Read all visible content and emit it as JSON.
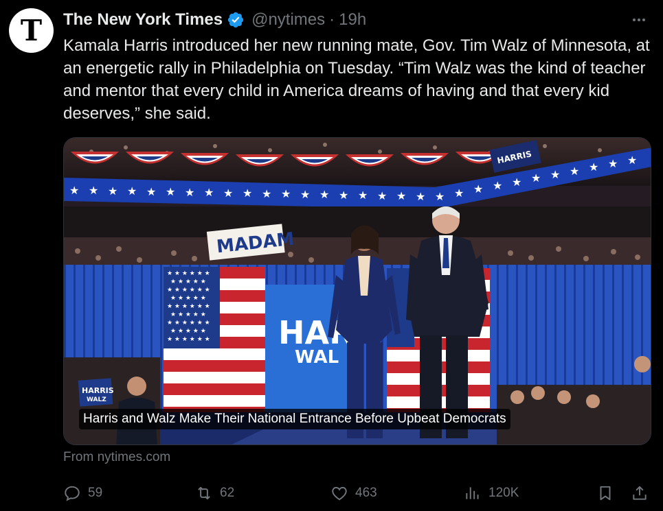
{
  "account": {
    "avatar_letter": "T",
    "name": "The New York Times",
    "handle": "@nytimes",
    "separator": "·",
    "time": "19h",
    "verified_color": "#1d9bf0"
  },
  "tweet": {
    "text": "Kamala Harris introduced her new running mate, Gov. Tim Walz of Minnesota, at an energetic rally in Philadelphia on Tuesday. “Tim Walz was the kind of teacher and mentor that every child in America dreams of having and that every kid deserves,” she said."
  },
  "card": {
    "caption": "Harris and Walz Make Their National Entrance Before Upbeat Democrats",
    "source": "From nytimes.com",
    "photo_signs": {
      "madam": "MADAM",
      "harris_left": "HARRIS",
      "walz_left": "WALZ",
      "harris_podium": "HAR",
      "walz_podium": "WAL",
      "harris_right": "HARRIS"
    }
  },
  "actions": {
    "replies": "59",
    "reposts": "62",
    "likes": "463",
    "views": "120K"
  },
  "icons": [
    "verified-badge-icon",
    "more-icon",
    "reply-icon",
    "repost-icon",
    "like-icon",
    "views-icon",
    "bookmark-icon",
    "share-icon"
  ]
}
